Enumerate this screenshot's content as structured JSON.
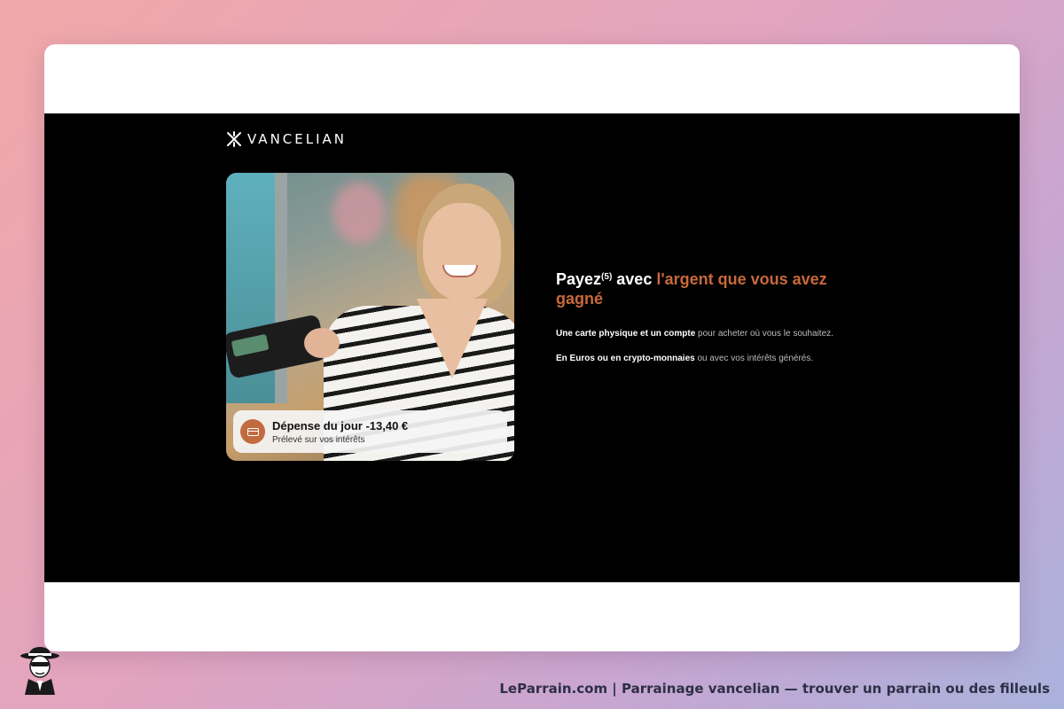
{
  "brand": {
    "logo_text": "VANCELIAN",
    "accent_color": "#c8693a"
  },
  "photo_card": {
    "spend_title": "Dépense du jour -13,40 €",
    "spend_subtitle": "Prélevé sur vos intérêts",
    "spend_icon": "credit-card-icon"
  },
  "headline": {
    "part1": "Payez",
    "superscript": "(5)",
    "part2": " avec ",
    "accent": "l'argent que vous avez gagné"
  },
  "paragraphs": [
    {
      "bold": "Une carte physique et un compte",
      "rest": " pour acheter où vous le souhaitez."
    },
    {
      "bold": "En Euros ou en crypto-monnaies",
      "rest": " ou avec vos intérêts générés."
    }
  ],
  "footer": {
    "caption": "LeParrain.com | Parrainage vancelian — trouver un parrain ou des filleuls"
  }
}
